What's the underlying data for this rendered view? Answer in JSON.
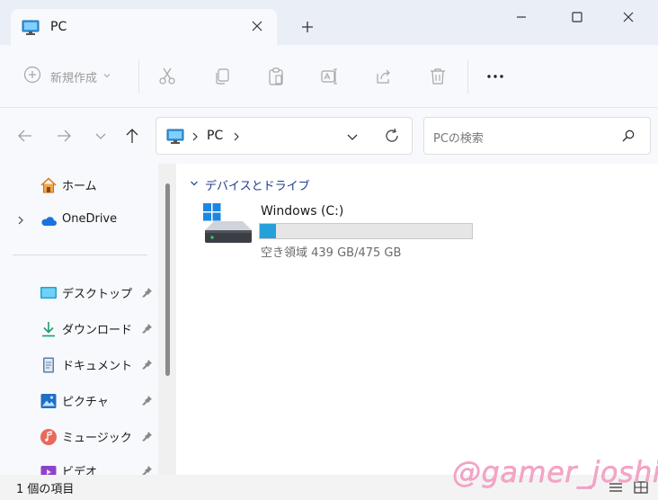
{
  "window": {
    "tab_title": "PC",
    "icons": [
      "pc-icon",
      "close-icon",
      "plus-icon",
      "minimize-icon",
      "maximize-icon",
      "window-close-icon"
    ]
  },
  "toolbar": {
    "new_label": "新規作成",
    "icons": [
      "cut-icon",
      "copy-icon",
      "paste-icon",
      "rename-icon",
      "share-icon",
      "delete-icon",
      "more-icon"
    ]
  },
  "nav": {
    "address": "PC",
    "search_placeholder": "PCの検索"
  },
  "sidebar": {
    "items": [
      {
        "label": "ホーム",
        "icon": "home-icon"
      },
      {
        "label": "OneDrive",
        "icon": "cloud-icon"
      },
      {
        "label": "デスクトップ",
        "icon": "desktop-icon"
      },
      {
        "label": "ダウンロード",
        "icon": "download-icon"
      },
      {
        "label": "ドキュメント",
        "icon": "document-icon"
      },
      {
        "label": "ピクチャ",
        "icon": "picture-icon"
      },
      {
        "label": "ミュージック",
        "icon": "music-icon"
      },
      {
        "label": "ビデオ",
        "icon": "video-icon"
      }
    ]
  },
  "content": {
    "group_label": "デバイスとドライブ",
    "drives": [
      {
        "name": "Windows (C:)",
        "free_text": "空き領域 439 GB/475 GB",
        "used_fraction": 0.076
      }
    ]
  },
  "status": {
    "item_count": "1 個の項目"
  },
  "watermark": "@gamer_joshi",
  "colors": {
    "accent": "#26a0da",
    "group_header": "#1f3b8a"
  }
}
